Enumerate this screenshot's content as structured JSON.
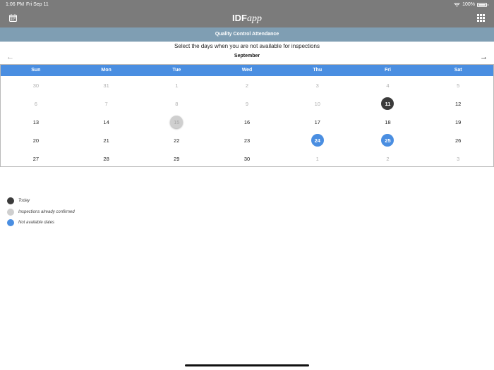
{
  "status_bar": {
    "time": "1:06 PM",
    "date": "Fri Sep 11",
    "battery": "100%"
  },
  "nav": {
    "title_strong": "IDF",
    "title_script": "app"
  },
  "section_header": "Quality Control Attendance",
  "instruction": "Select the days when you are not available for inspections",
  "calendar": {
    "month": "September",
    "prev_arrow": "←",
    "next_arrow": "→",
    "weekdays": [
      "Sun",
      "Mon",
      "Tue",
      "Wed",
      "Thu",
      "Fri",
      "Sat"
    ],
    "weeks": [
      [
        {
          "d": "30",
          "s": "other"
        },
        {
          "d": "31",
          "s": "other"
        },
        {
          "d": "1",
          "s": "other"
        },
        {
          "d": "2",
          "s": "other"
        },
        {
          "d": "3",
          "s": "other"
        },
        {
          "d": "4",
          "s": "other"
        },
        {
          "d": "5",
          "s": "other"
        }
      ],
      [
        {
          "d": "6",
          "s": "other"
        },
        {
          "d": "7",
          "s": "other"
        },
        {
          "d": "8",
          "s": "other"
        },
        {
          "d": "9",
          "s": "other"
        },
        {
          "d": "10",
          "s": "other"
        },
        {
          "d": "11",
          "s": "today"
        },
        {
          "d": "12",
          "s": "normal"
        }
      ],
      [
        {
          "d": "13",
          "s": "normal"
        },
        {
          "d": "14",
          "s": "normal"
        },
        {
          "d": "15",
          "s": "confirmed"
        },
        {
          "d": "16",
          "s": "normal"
        },
        {
          "d": "17",
          "s": "normal"
        },
        {
          "d": "18",
          "s": "normal"
        },
        {
          "d": "19",
          "s": "normal"
        }
      ],
      [
        {
          "d": "20",
          "s": "normal"
        },
        {
          "d": "21",
          "s": "normal"
        },
        {
          "d": "22",
          "s": "normal"
        },
        {
          "d": "23",
          "s": "normal"
        },
        {
          "d": "24",
          "s": "unavailable"
        },
        {
          "d": "25",
          "s": "unavailable"
        },
        {
          "d": "26",
          "s": "normal"
        }
      ],
      [
        {
          "d": "27",
          "s": "normal"
        },
        {
          "d": "28",
          "s": "normal"
        },
        {
          "d": "29",
          "s": "normal"
        },
        {
          "d": "30",
          "s": "normal"
        },
        {
          "d": "1",
          "s": "other"
        },
        {
          "d": "2",
          "s": "other"
        },
        {
          "d": "3",
          "s": "other"
        }
      ]
    ]
  },
  "legend": [
    {
      "label": "Today",
      "color": "#3b3b3b"
    },
    {
      "label": "Inspections already confirmed",
      "color": "#cfcfcf"
    },
    {
      "label": "Not available dates",
      "color": "#4a8ee1"
    }
  ],
  "colors": {
    "header_gray": "#7b7b7b",
    "section_blue_gray": "#7f9eb3",
    "accent_blue": "#4a8ee1",
    "today_dark": "#3b3b3b"
  },
  "icons": {
    "left_nav": "calendar-icon",
    "right_nav": "grid-icon"
  }
}
